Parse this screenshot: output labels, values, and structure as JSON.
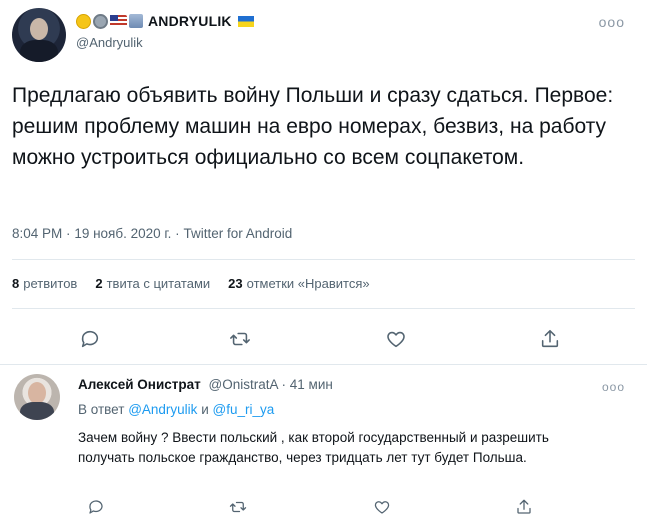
{
  "tweet": {
    "author": {
      "display_name": "ANDRYULIK",
      "handle": "@Andryulik",
      "name_emojis": [
        "smile-emoji",
        "gear-emoji",
        "us-flag-emoji",
        "building-emoji"
      ],
      "trailing_flag": "ukraine-flag"
    },
    "text": "Предлагаю объявить войну Польши и сразу сдаться. Первое: решим проблему машин на евро номерах, безвиз, на работу можно устроиться официально со всем соцпакетом.",
    "time": "8:04 PM",
    "date": "19 нояб. 2020 г.",
    "source": "Twitter for Android",
    "stats": {
      "retweets_count": "8",
      "retweets_label": "ретвитов",
      "quotes_count": "2",
      "quotes_label": "твита с цитатами",
      "likes_count": "23",
      "likes_label": "отметки «Нравится»"
    }
  },
  "reply": {
    "display_name": "Алексей Онистрат",
    "handle": "@OnistratA",
    "time_ago": "41 мин",
    "replying_prefix": "В ответ",
    "replying_to_1": "@Andryulik",
    "replying_conj": "и",
    "replying_to_2": "@fu_ri_ya",
    "text": "Зачем войну ? Ввести польский , как второй государственный  и разрешить получать  польское гражданство, через тридцать лет тут будет Польша."
  },
  "separators": {
    "meta_dot": "·",
    "more": "ooo"
  },
  "colors": {
    "accent": "#1d9bf0",
    "muted": "#536471",
    "text": "#0f1419"
  }
}
